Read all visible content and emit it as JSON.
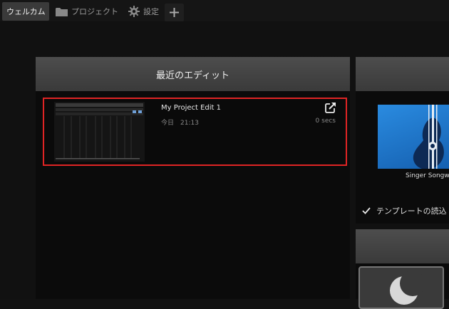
{
  "tabs": [
    {
      "label": "ウェルカム",
      "active": true,
      "icon": null
    },
    {
      "label": "プロジェクト",
      "active": false,
      "icon": "folder-icon"
    },
    {
      "label": "設定",
      "active": false,
      "icon": "gear-icon"
    }
  ],
  "recent": {
    "header": "最近のエディット",
    "items": [
      {
        "title": "My Project Edit 1",
        "date": "今日　21:13",
        "duration": "0 secs"
      }
    ]
  },
  "templates": {
    "card_label": "Singer Songw",
    "load_checkbox_label": "テンプレートの読込",
    "load_checked": true
  },
  "colors": {
    "accent": "#e02424",
    "card_blue": "#2a8be0"
  }
}
